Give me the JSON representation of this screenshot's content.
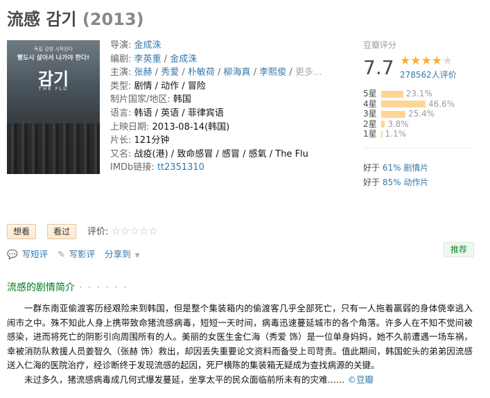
{
  "title": {
    "name": "流感 감기",
    "year": "(2013)"
  },
  "poster": {
    "tagline1": "독립 감염 시작된다",
    "tagline2": "빨도시 살아서 나가야 한다!",
    "logo": "감기",
    "logo_en": "THE FLU"
  },
  "info": {
    "director_label": "导演:",
    "director": "金成洙",
    "writer_label": "编剧:",
    "writers": [
      "李英重",
      "金成洙"
    ],
    "cast_label": "主演:",
    "cast": [
      "张赫",
      "秀爱",
      "朴敏荷",
      "柳海真",
      "李熙俊"
    ],
    "cast_more": "更多...",
    "genre_label": "类型:",
    "genres": "剧情 / 动作 / 冒险",
    "country_label": "制片国家/地区:",
    "country": "韩国",
    "language_label": "语言:",
    "language": "韩语 / 英语 / 菲律宾语",
    "release_label": "上映日期:",
    "release": "2013-08-14(韩国)",
    "runtime_label": "片长:",
    "runtime": "121分钟",
    "aka_label": "又名:",
    "aka": "战疫(港) / 致命感冒 / 感冒 / 感氣 / The Flu",
    "imdb_label": "IMDb链接:",
    "imdb": "tt2351310"
  },
  "rating": {
    "title": "豆瓣评分",
    "score": "7.7",
    "stars_on": "★★★★",
    "stars_off": "★",
    "votes": "278562人评价",
    "breakdown": [
      {
        "label": "5星",
        "pct": "23.1%",
        "value": 23.1
      },
      {
        "label": "4星",
        "pct": "46.6%",
        "value": 46.6
      },
      {
        "label": "3星",
        "pct": "25.4%",
        "value": 25.4
      },
      {
        "label": "2星",
        "pct": "3.8%",
        "value": 3.8
      },
      {
        "label": "1星",
        "pct": "1.1%",
        "value": 1.1
      }
    ],
    "better1_pre": "好于 ",
    "better1_link": "61% 剧情片",
    "better2_pre": "好于 ",
    "better2_link": "85% 动作片"
  },
  "actions": {
    "want": "想看",
    "watched": "看过",
    "my_rating_label": "评价:",
    "my_stars": "☆☆☆☆☆",
    "write_short": "写短评",
    "write_review": "写影评",
    "share": "分享到",
    "recommend": "推荐"
  },
  "summary": {
    "heading": "流感的剧情简介",
    "dots": "· · · · · ·",
    "p1": "一群东南亚偷渡客历经艰险来到韩国，但是整个集装箱内的偷渡客几乎全部死亡，只有一人拖着羸弱的身体侥幸逃入闹市之中。殊不知此人身上携带致命猪流感病毒，短短一天时间，病毒迅速蔓延城市的各个角落。许多人在不知不觉间被感染，进而将死亡的阴影引向周围所有的人。美丽的女医生金仁海（秀爱 饰）是一位单身妈妈，她不久前遭遇一场车祸，幸被消防队救援人员姜智久（张赫 饰）救出，却因丢失重要论文资料而备受上司苛责。值此期间，韩国蛇头的弟弟因流感送入仁海的医院治疗，经诊断终于发现流感的起因，死尸横陈的集装箱无疑成为查找病源的关键。",
    "p2": "未过多久，猪流感病毒成几何式爆发蔓延，坐享太平的民众面临前所未有的灾难……",
    "source": "©豆瓣"
  }
}
